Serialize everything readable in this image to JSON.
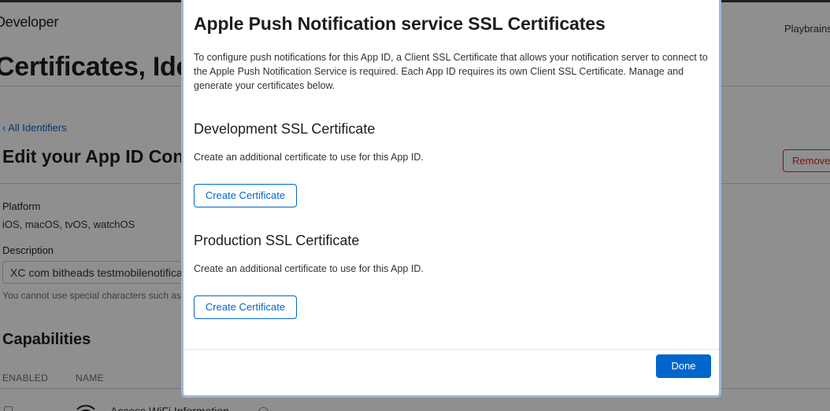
{
  "header": {
    "brand": "Developer",
    "team": "Playbrains"
  },
  "page": {
    "title": "Certificates, Identifiers & Profiles",
    "back_link": "‹ All Identifiers",
    "edit_title": "Edit your App ID Configuration",
    "remove_button": "Remove",
    "platform_label": "Platform",
    "platform_value": "iOS, macOS, tvOS, watchOS",
    "description_label": "Description",
    "description_value": "XC com bitheads testmobilenotifications",
    "description_hint": "You cannot use special characters such as @, &, *, ', \"",
    "capabilities_title": "Capabilities",
    "columns": {
      "enabled": "ENABLED",
      "name": "NAME"
    },
    "first_capability": "Access WiFi Information"
  },
  "modal": {
    "title": "Apple Push Notification service SSL Certificates",
    "intro": "To configure push notifications for this App ID, a Client SSL Certificate that allows your notification server to connect to the Apple Push Notification Service is required. Each App ID requires its own Client SSL Certificate. Manage and generate your certificates below.",
    "sections": [
      {
        "title": "Development SSL Certificate",
        "description": "Create an additional certificate to use for this App ID.",
        "button": "Create Certificate"
      },
      {
        "title": "Production SSL Certificate",
        "description": "Create an additional certificate to use for this App ID.",
        "button": "Create Certificate"
      }
    ],
    "done_button": "Done"
  },
  "colors": {
    "accent": "#0066cc",
    "danger": "#d92d20",
    "overlay": "rgba(0,0,0,0.44)"
  }
}
